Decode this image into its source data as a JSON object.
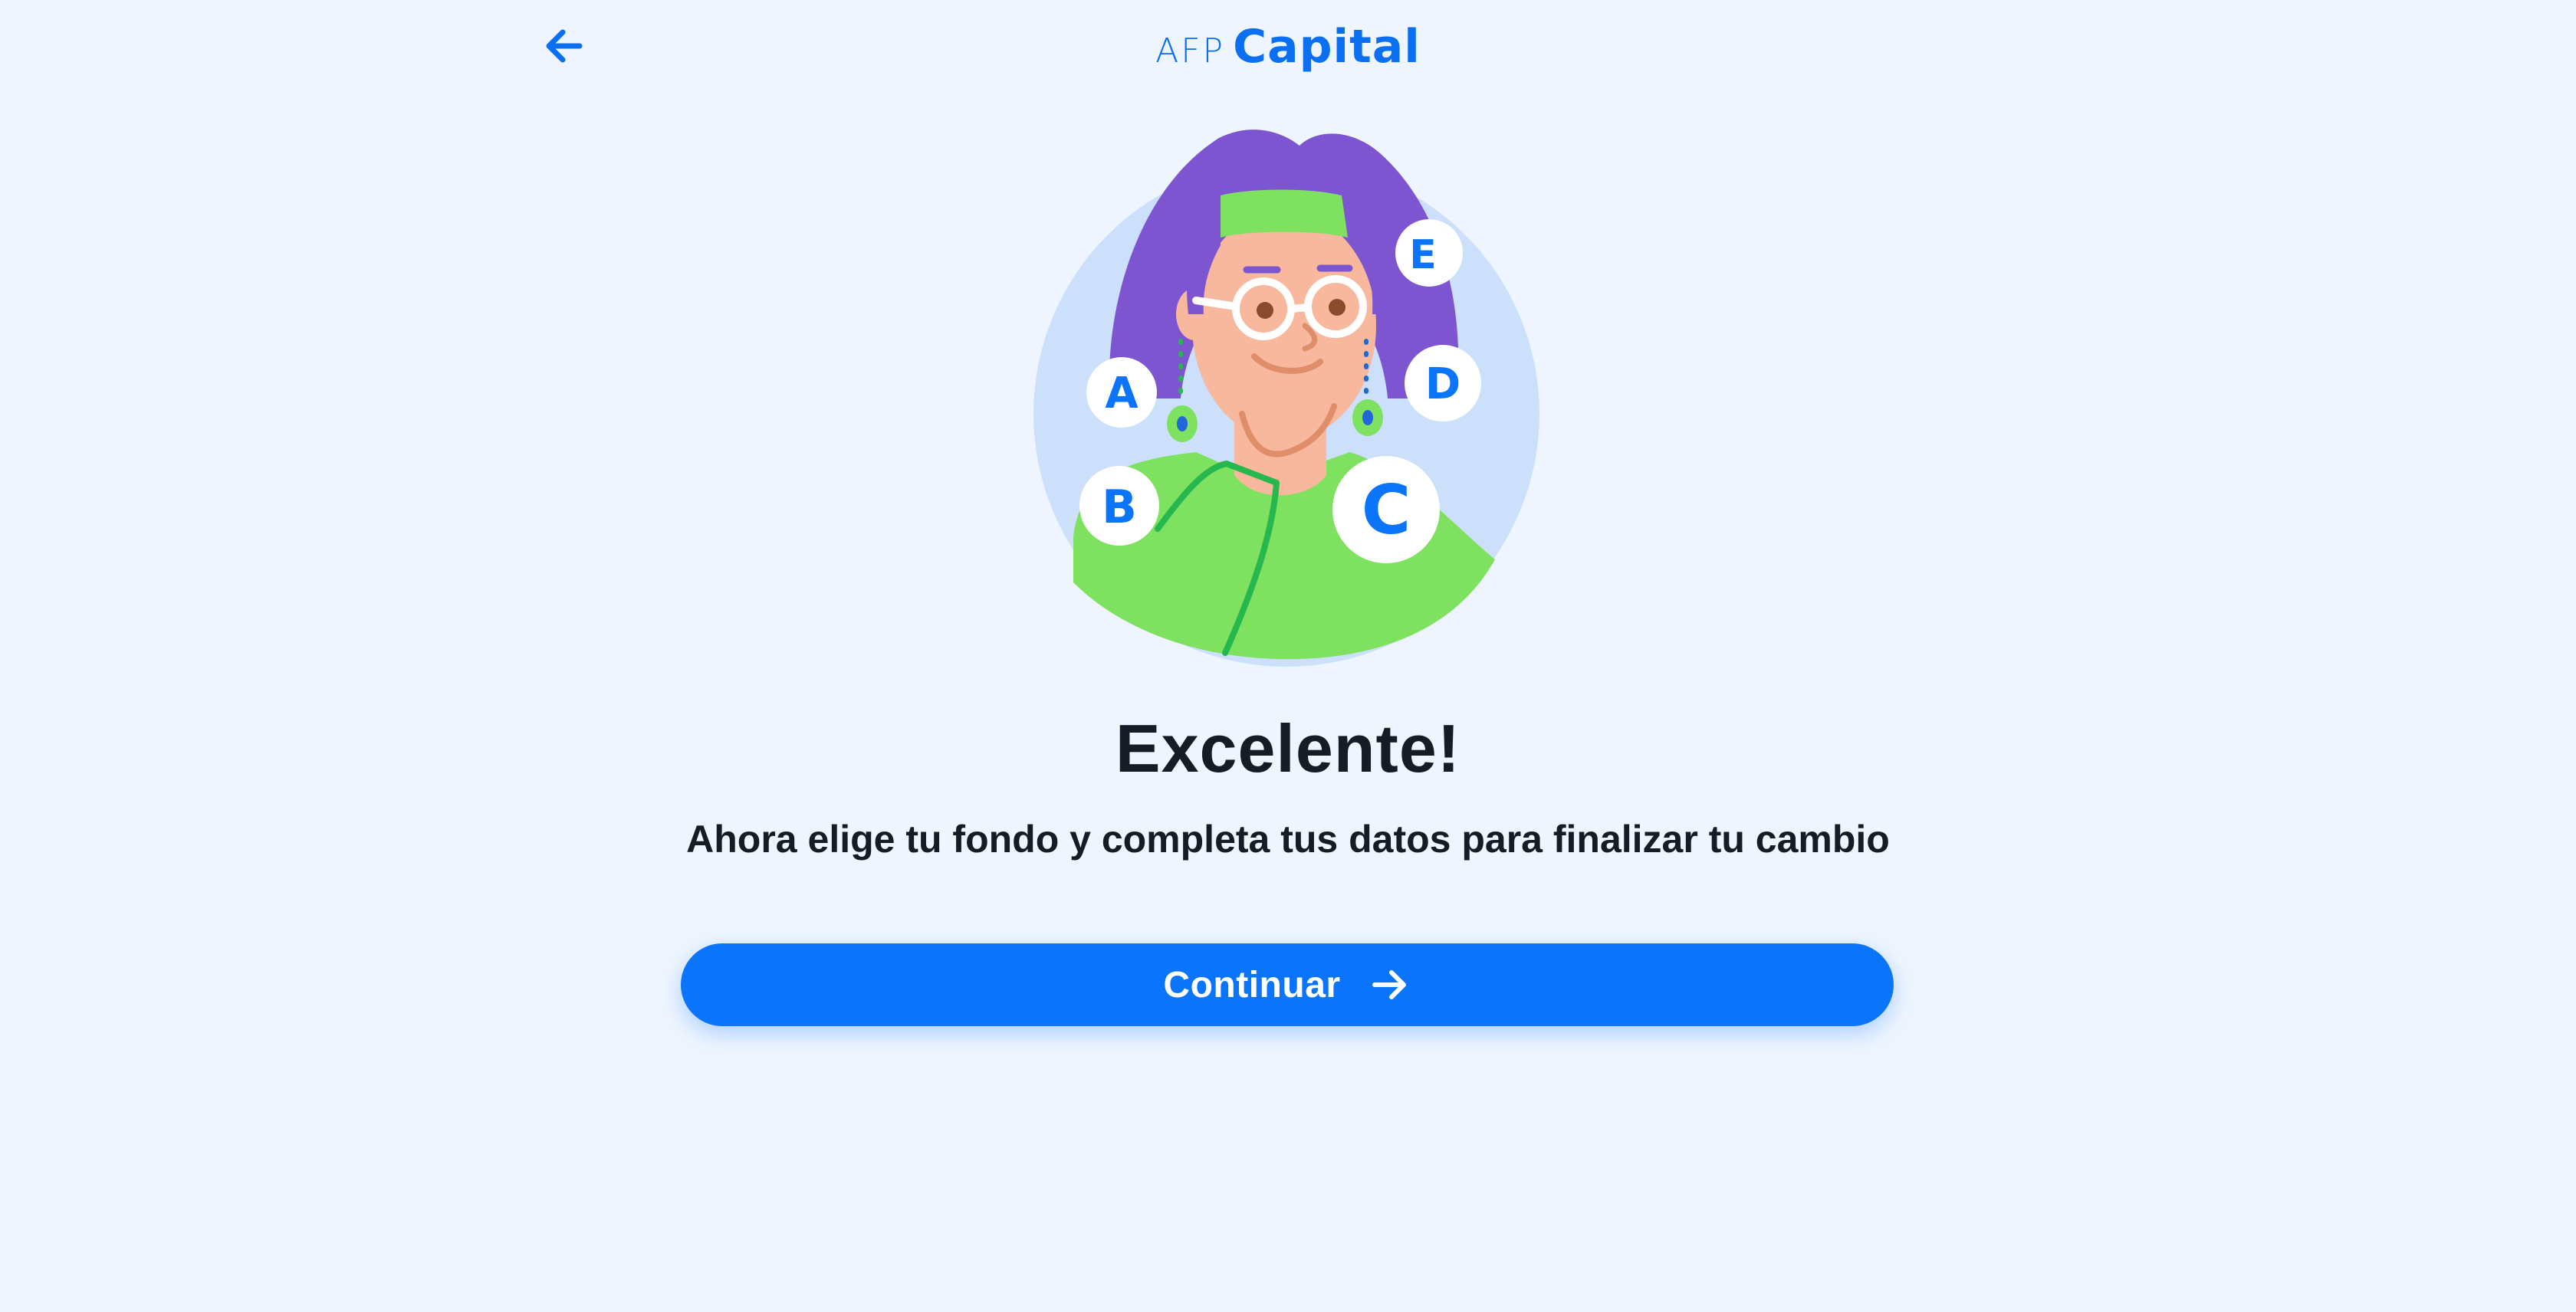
{
  "header": {
    "back_icon": "arrow-left-icon",
    "logo": {
      "prefix": "AFP",
      "name": "Capital",
      "color": "#0a6ff0"
    }
  },
  "illustration": {
    "description_icon": "woman-choosing-fund-illustration",
    "fund_letters": [
      "A",
      "B",
      "C",
      "D",
      "E"
    ]
  },
  "main": {
    "title": "Excelente!",
    "subtitle": "Ahora elige tu fondo y completa tus datos para finalizar tu cambio"
  },
  "actions": {
    "continue_label": "Continuar",
    "continue_icon": "arrow-right-icon",
    "button_color": "#0a74fb"
  },
  "colors": {
    "background": "#eef5fe",
    "text": "#161b26",
    "accent": "#0a6ff0"
  }
}
